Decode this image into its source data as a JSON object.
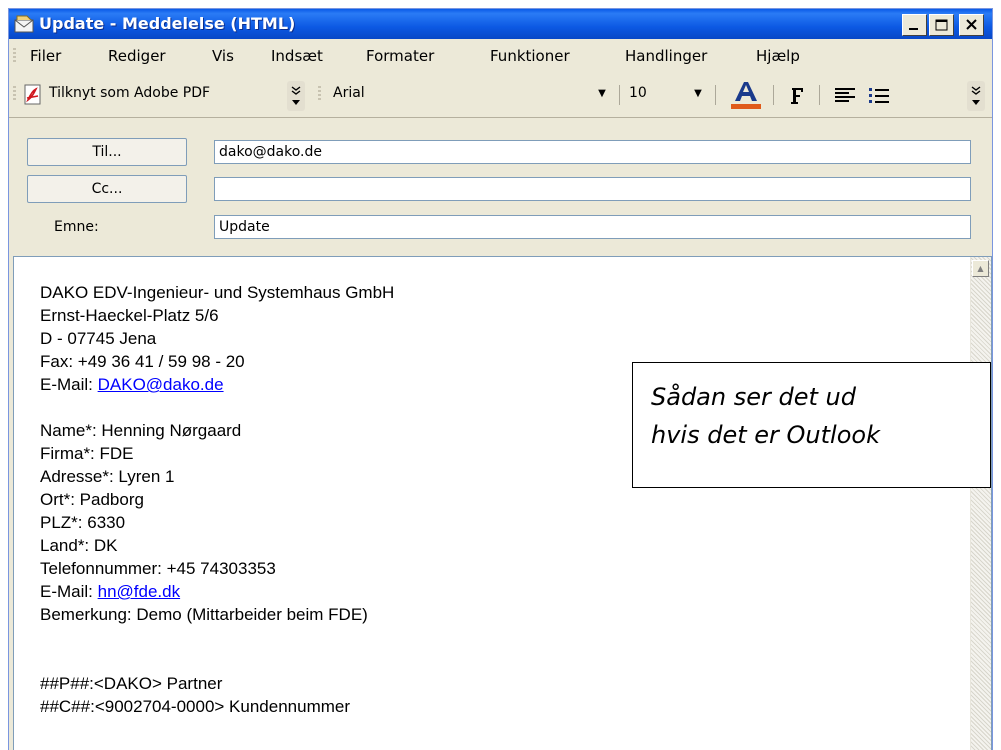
{
  "window": {
    "title": "Update - Meddelelse (HTML)",
    "icon": "envelope-icon",
    "controls": {
      "minimize": "minimize-icon",
      "maximize": "maximize-icon",
      "close": "close-icon"
    }
  },
  "menu": [
    "Filer",
    "Rediger",
    "Vis",
    "Indsæt",
    "Formater",
    "Funktioner",
    "Handlinger",
    "Hjælp"
  ],
  "toolbar": {
    "attach_pdf_label": "Tilknyt som Adobe PDF",
    "font_name": "Arial",
    "font_size": "10",
    "font_color_icon": "font-color-icon",
    "bold_icon": "bold-icon",
    "align_icon": "align-left-icon",
    "bullets_icon": "bullet-list-icon",
    "accent_color": "#e05a1a"
  },
  "header": {
    "to_button": "Til...",
    "to_value": "dako@dako.de",
    "cc_button": "Cc...",
    "cc_value": "",
    "subject_label": "Emne:",
    "subject_value": "Update"
  },
  "body": {
    "company": "DAKO EDV-Ingenieur- und Systemhaus GmbH",
    "street": "Ernst-Haeckel-Platz 5/6",
    "city": "D - 07745 Jena",
    "fax": "Fax: +49 36 41 / 59 98 - 20",
    "email_label": "E-Mail: ",
    "email_link": "DAKO@dako.de",
    "name": "Name*: Henning Nørgaard",
    "firma": "Firma*: FDE",
    "adresse": "Adresse*: Lyren 1",
    "ort": "Ort*: Padborg",
    "plz": "PLZ*: 6330",
    "land": "Land*: DK",
    "telefon": "Telefonnummer: +45 74303353",
    "email2_label": "E-Mail: ",
    "email2_link": "hn@fde.dk",
    "bemerkung": "Bemerkung: Demo (Mittarbeider beim FDE)",
    "partner": "##P##:<DAKO> Partner",
    "kunde": "##C##:<9002704-0000> Kundennummer"
  },
  "callout": {
    "line1": "Sådan ser det ud",
    "line2": "hvis det er Outlook"
  }
}
